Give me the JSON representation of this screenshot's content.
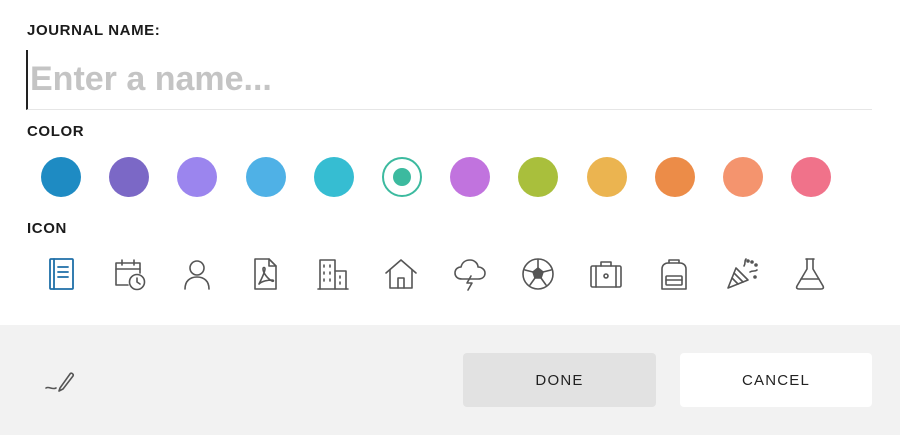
{
  "journal_name": {
    "label": "JOURNAL NAME:",
    "value": "",
    "placeholder": "Enter a name..."
  },
  "color": {
    "label": "COLOR",
    "selected": "teal",
    "options": [
      {
        "name": "blue",
        "hex": "#1e8bc3"
      },
      {
        "name": "indigo",
        "hex": "#7b68c6"
      },
      {
        "name": "lavender",
        "hex": "#9b85ee"
      },
      {
        "name": "sky-blue",
        "hex": "#4fb1e6"
      },
      {
        "name": "cyan",
        "hex": "#36bdd2"
      },
      {
        "name": "teal",
        "hex": "#3cba9f"
      },
      {
        "name": "violet",
        "hex": "#c173de"
      },
      {
        "name": "olive-green",
        "hex": "#a9bf3c"
      },
      {
        "name": "yellow-orange",
        "hex": "#ebb450"
      },
      {
        "name": "orange",
        "hex": "#ec8c48"
      },
      {
        "name": "salmon",
        "hex": "#f4946e"
      },
      {
        "name": "pink-red",
        "hex": "#f0728a"
      }
    ]
  },
  "icon": {
    "label": "ICON",
    "selected": "notebook-icon",
    "options": [
      "notebook-icon",
      "calendar-clock-icon",
      "person-icon",
      "pdf-document-icon",
      "buildings-icon",
      "house-icon",
      "storm-cloud-icon",
      "soccer-ball-icon",
      "suitcase-icon",
      "backpack-icon",
      "party-popper-icon",
      "flask-icon"
    ],
    "selected_color": "#1e6fa8",
    "default_color": "#555555"
  },
  "footer": {
    "pen_icon": "pen-icon",
    "done_label": "DONE",
    "cancel_label": "CANCEL"
  }
}
